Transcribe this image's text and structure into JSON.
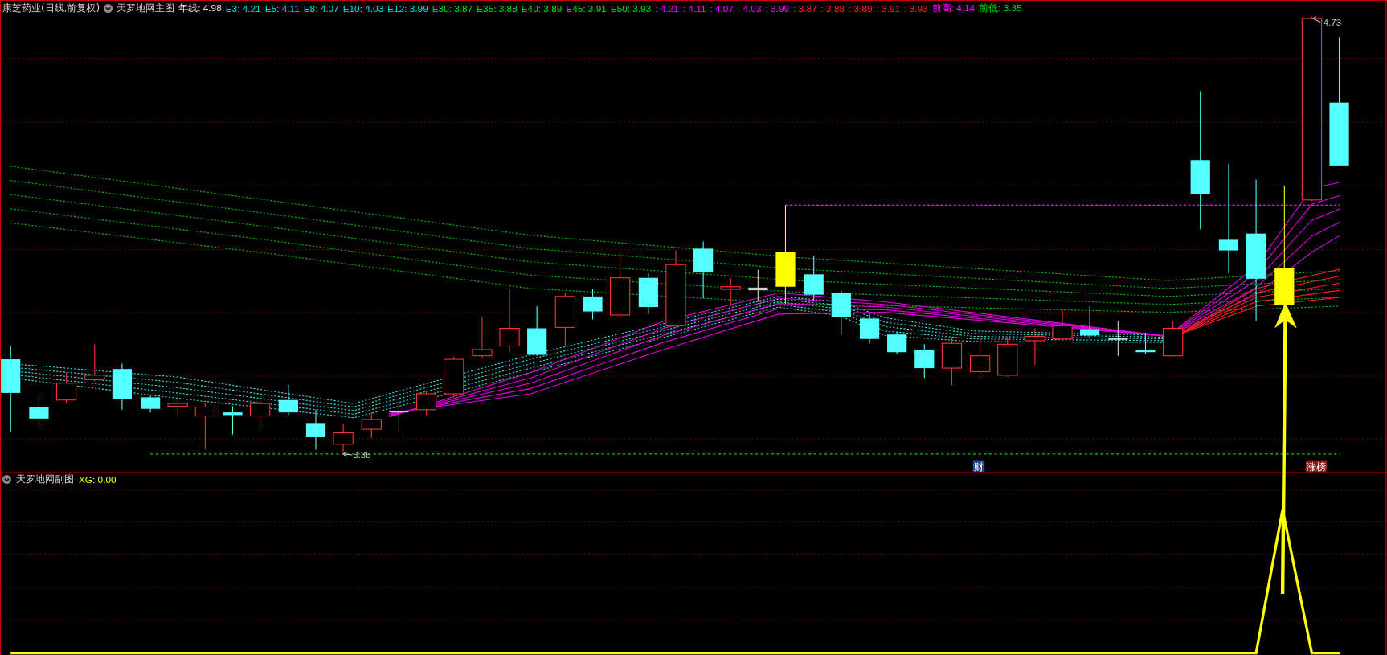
{
  "main_panel": {
    "stock_title": "康芝药业(日线,前复权)",
    "indicator_name": "天罗地网主图",
    "readings": [
      {
        "text": "年线: 4.98",
        "color": "#e6e6e6"
      },
      {
        "text": "E3: 4.21",
        "color": "#00e0e0"
      },
      {
        "text": "E5: 4.11",
        "color": "#00e0e0"
      },
      {
        "text": "E8: 4.07",
        "color": "#00e0e0"
      },
      {
        "text": "E10: 4.03",
        "color": "#00e0e0"
      },
      {
        "text": "E12: 3.99",
        "color": "#00e0e0"
      },
      {
        "text": "E30: 3.87",
        "color": "#00e000"
      },
      {
        "text": "E35: 3.88",
        "color": "#00e000"
      },
      {
        "text": "E40: 3.89",
        "color": "#00e000"
      },
      {
        "text": "E45: 3.91",
        "color": "#00e000"
      },
      {
        "text": "E50: 3.93",
        "color": "#00e000"
      },
      {
        "text": ": 4.21",
        "color": "#ff00ff"
      },
      {
        "text": ": 4.11",
        "color": "#ff00ff"
      },
      {
        "text": ": 4.07",
        "color": "#ff00ff"
      },
      {
        "text": ": 4.03",
        "color": "#ff00ff"
      },
      {
        "text": ": 3.99",
        "color": "#ff00ff"
      },
      {
        "text": ": 3.87",
        "color": "#ff2020"
      },
      {
        "text": ": 3.88",
        "color": "#ff2020"
      },
      {
        "text": ": 3.89",
        "color": "#ff2020"
      },
      {
        "text": ": 3.91",
        "color": "#ff2020"
      },
      {
        "text": ": 3.93",
        "color": "#ff2020"
      },
      {
        "text": "前高: 4.14",
        "color": "#ff00ff"
      },
      {
        "text": "前低: 3.35",
        "color": "#00e000"
      }
    ],
    "low_marker": "3.35",
    "high_marker": "4.73",
    "event_tags": [
      {
        "text": "财",
        "color": "#1f4f8f"
      },
      {
        "text": "涨榜",
        "color": "#8b1a1a"
      }
    ]
  },
  "sub_panel": {
    "indicator_name": "天罗地网副图",
    "reading": {
      "text": "XG: 0.00",
      "color": "#ffff00"
    }
  }
}
